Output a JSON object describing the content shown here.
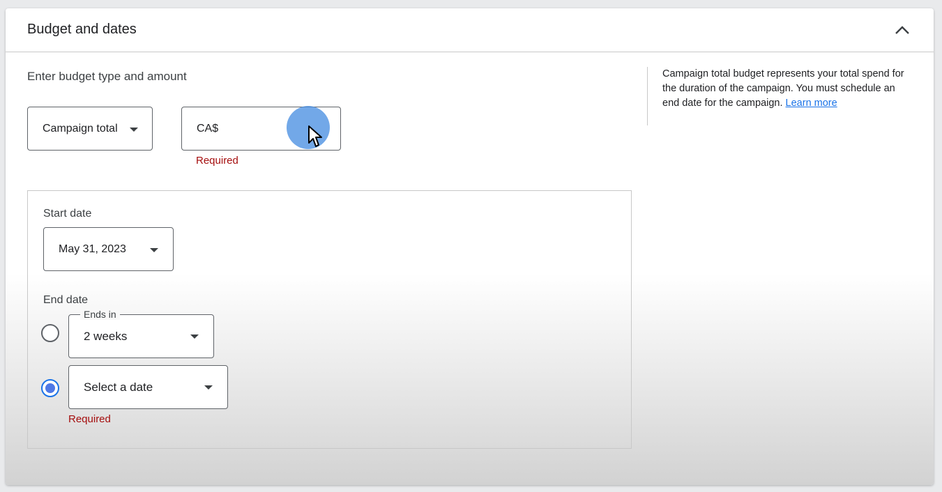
{
  "header": {
    "title": "Budget and dates",
    "collapse_icon": "chevron-up-icon"
  },
  "budget": {
    "label": "Enter budget type and amount",
    "type_value": "Campaign total",
    "amount_prefix": "CA$",
    "amount_value": "",
    "amount_required": "Required"
  },
  "dates": {
    "start_label": "Start date",
    "start_value": "May 31, 2023",
    "end_label": "End date",
    "ends_in_legend": "Ends in",
    "ends_in_value": "2 weeks",
    "select_date_value": "Select a date",
    "date_required": "Required",
    "selected_option": "select_date"
  },
  "help": {
    "text": "Campaign total budget represents your total spend for the duration of the campaign. You must schedule an end date for the campaign.",
    "link": "Learn more"
  },
  "colors": {
    "accent": "#1a73e8",
    "error": "#a50e0e",
    "radio_fill": "#4f79e6"
  }
}
